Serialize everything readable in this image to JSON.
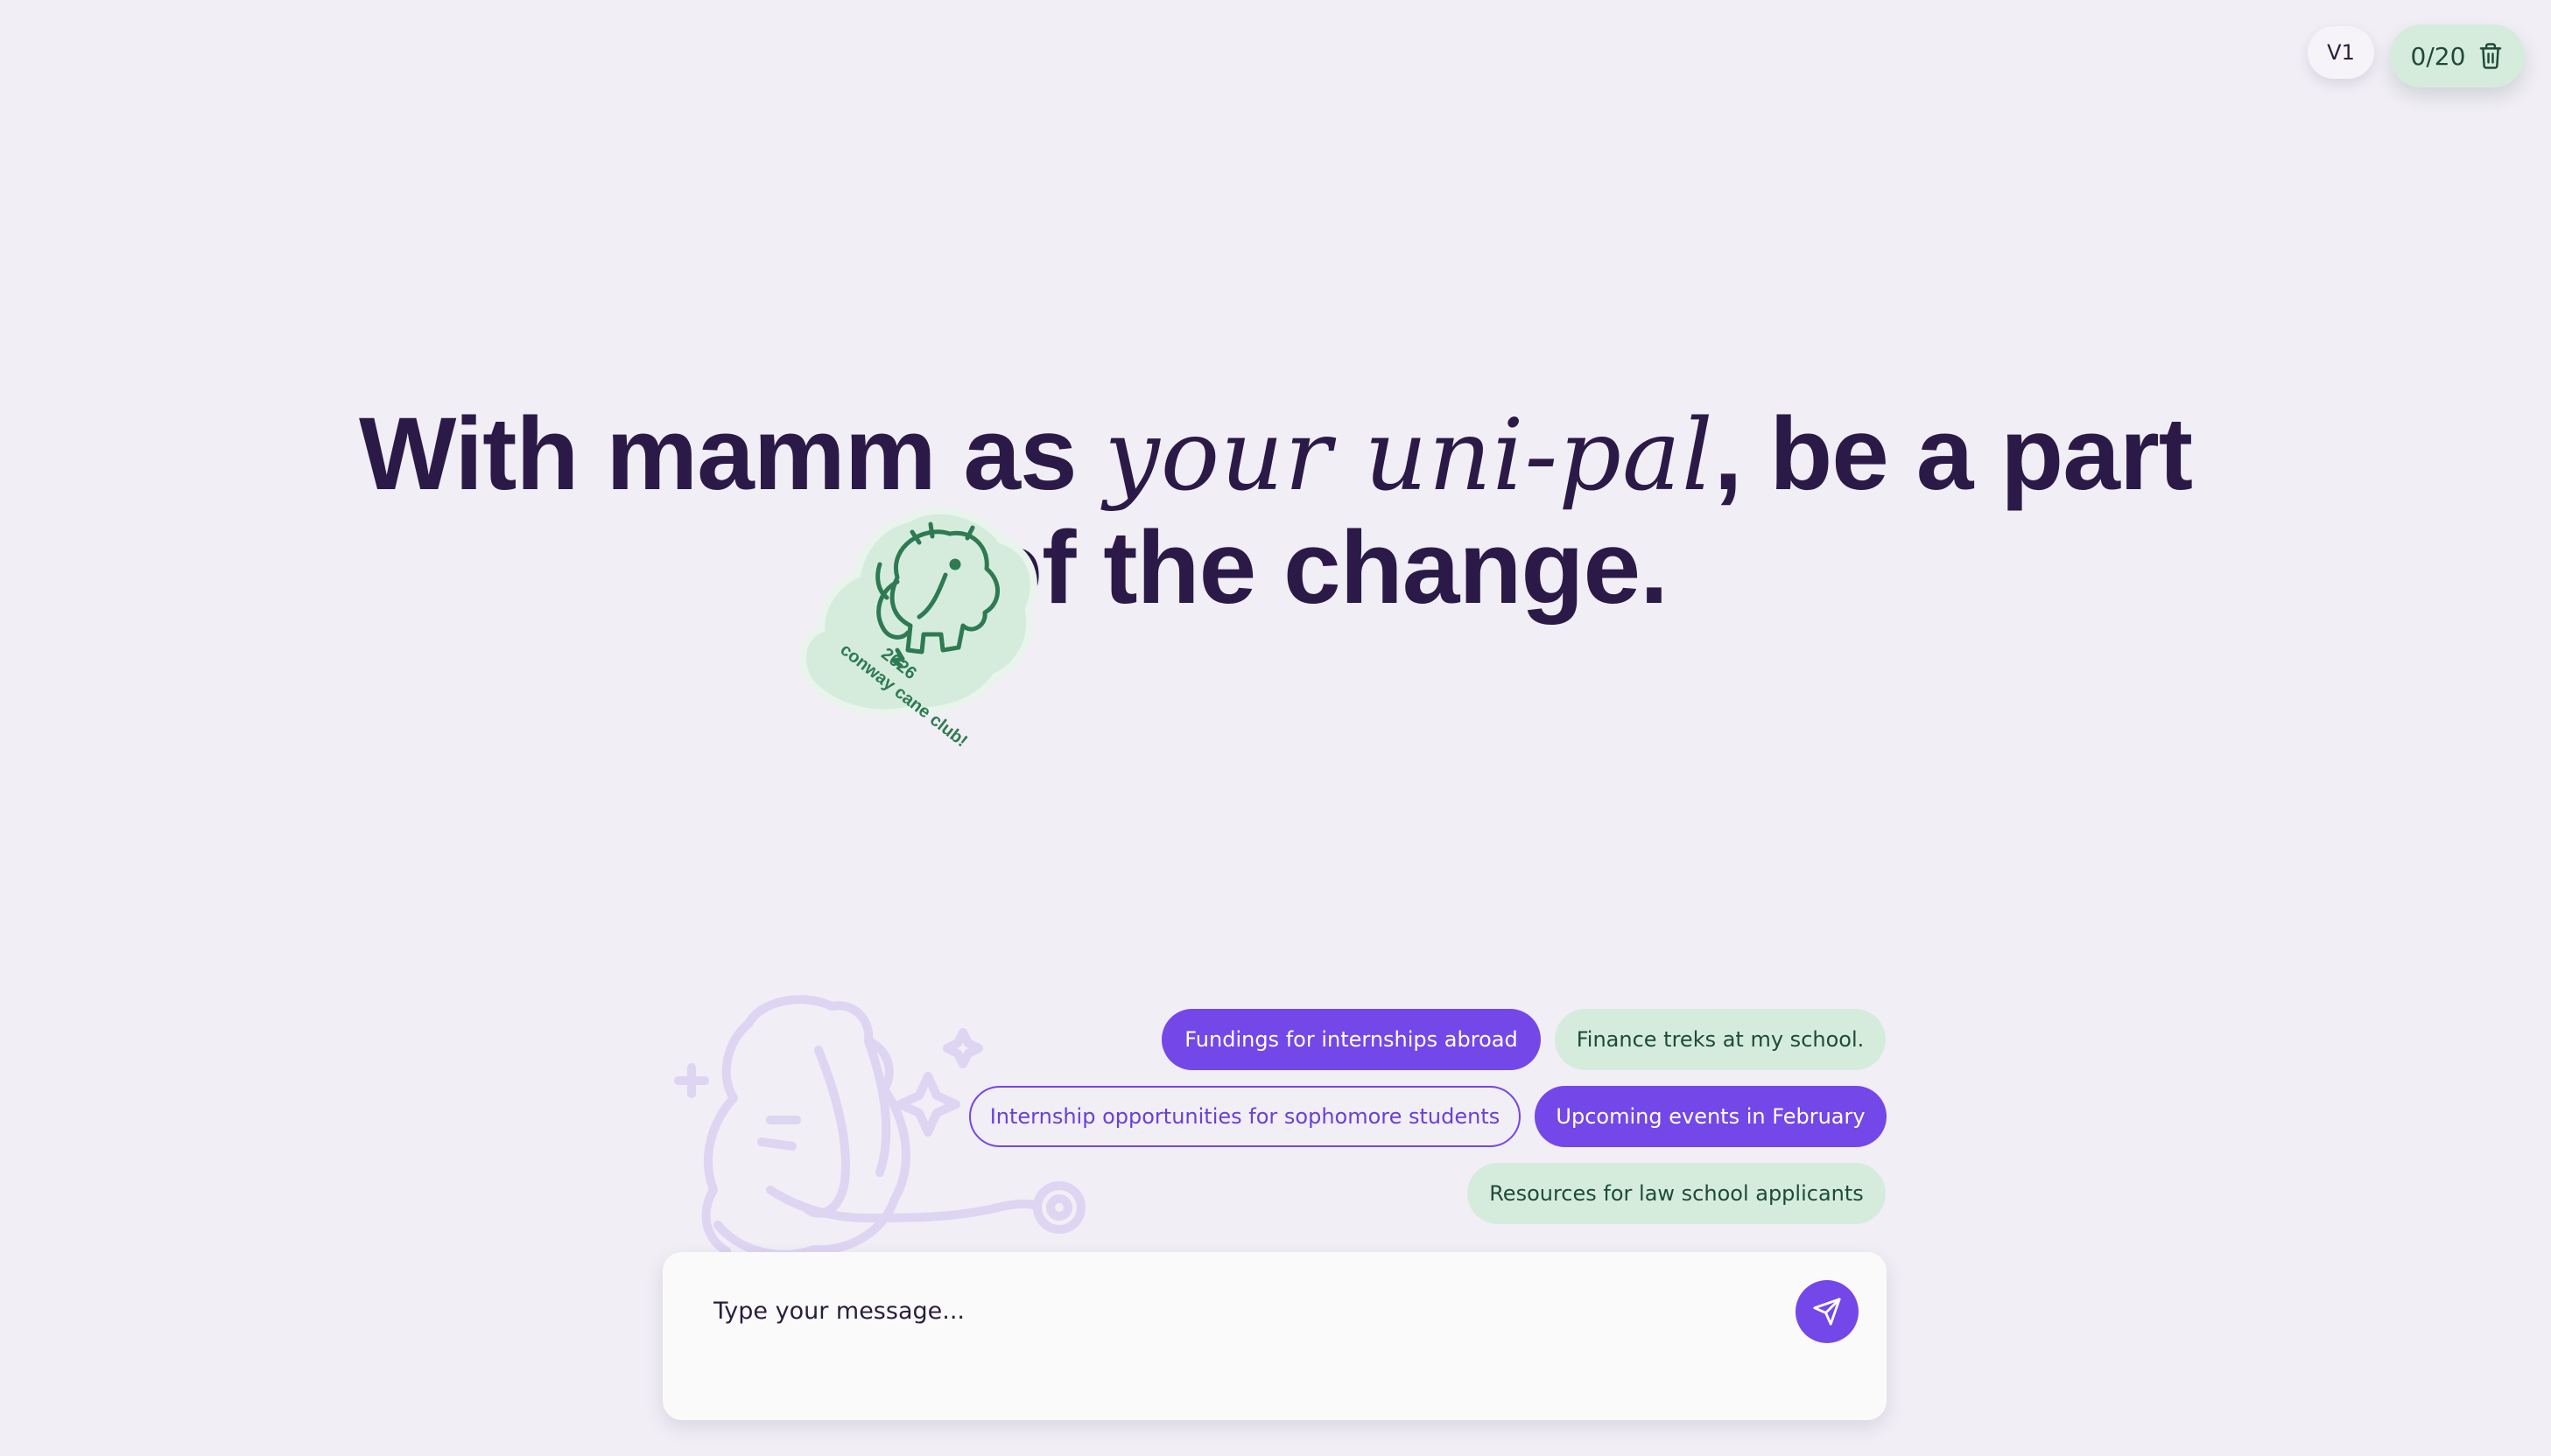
{
  "header": {
    "version_label": "V1",
    "counter_label": "0/20"
  },
  "hero": {
    "headline_start": "With mamm as ",
    "headline_italic": "your uni-pal",
    "headline_end": ", be a part",
    "headline_line2": "of the change."
  },
  "sticker": {
    "text_line1": "2026",
    "text_line2": "conway cane club!"
  },
  "suggestions": [
    {
      "label": "Fundings for internships abroad",
      "style": "filled"
    },
    {
      "label": "Finance treks at my school.",
      "style": "mint"
    },
    {
      "label": "Internship opportunities for sophomore students",
      "style": "outline"
    },
    {
      "label": "Upcoming events in February",
      "style": "filled"
    },
    {
      "label": "Resources for law school applicants",
      "style": "mint"
    }
  ],
  "composer": {
    "placeholder": "Type your message..."
  },
  "icons": {
    "trash": "trash-icon",
    "send": "send-icon",
    "mascot": "mammoth-icon"
  },
  "colors": {
    "accent": "#7447e8",
    "mint": "#d5ecdd",
    "headline": "#2b1a47",
    "background": "#f1eef5"
  }
}
